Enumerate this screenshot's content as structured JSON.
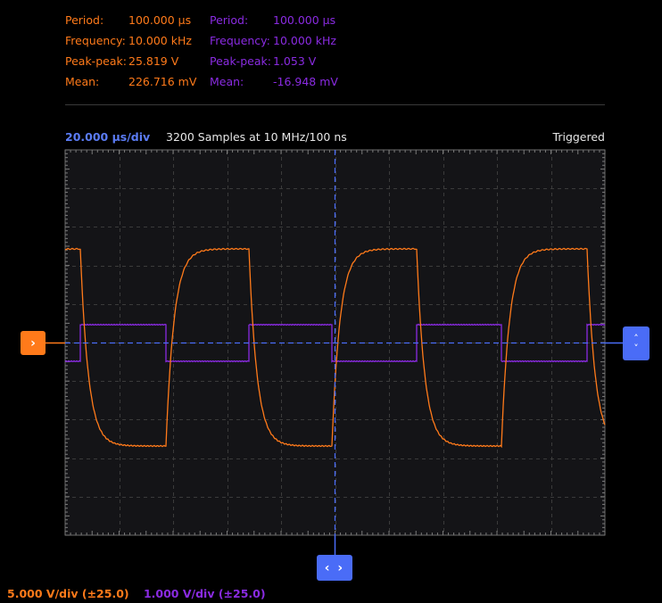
{
  "measurements": {
    "ch1": [
      {
        "key": "Period:",
        "value": "100.000 µs"
      },
      {
        "key": "Frequency:",
        "value": "10.000 kHz"
      },
      {
        "key": "Peak-peak:",
        "value": "25.819 V"
      },
      {
        "key": "Mean:",
        "value": "226.716 mV"
      }
    ],
    "ch2": [
      {
        "key": "Period:",
        "value": "100.000 µs"
      },
      {
        "key": "Frequency:",
        "value": "10.000 kHz"
      },
      {
        "key": "Peak-peak:",
        "value": "1.053 V"
      },
      {
        "key": "Mean:",
        "value": "-16.948 mV"
      }
    ]
  },
  "timebase": {
    "per_div": "20.000 µs/div",
    "samples": "3200 Samples at 10 MHz/100 ns",
    "status": "Triggered"
  },
  "channels": {
    "ch1_scale": "5.000 V/div (±25.0)",
    "ch2_scale": "1.000 V/div (±25.0)"
  },
  "handles": {
    "ch1": "›",
    "trigger_up": "˄",
    "trigger_down": "˅",
    "time": "‹ ›"
  },
  "colors": {
    "ch1": "#ff7a1a",
    "ch2": "#8a2be2",
    "accent": "#4a6cf7",
    "grid_bg": "#141417",
    "grid_line": "#3b3b3b"
  },
  "icons": [
    "chevron-right-icon",
    "chevron-up-icon",
    "chevron-down-icon",
    "chevron-left-right-icon"
  ]
}
